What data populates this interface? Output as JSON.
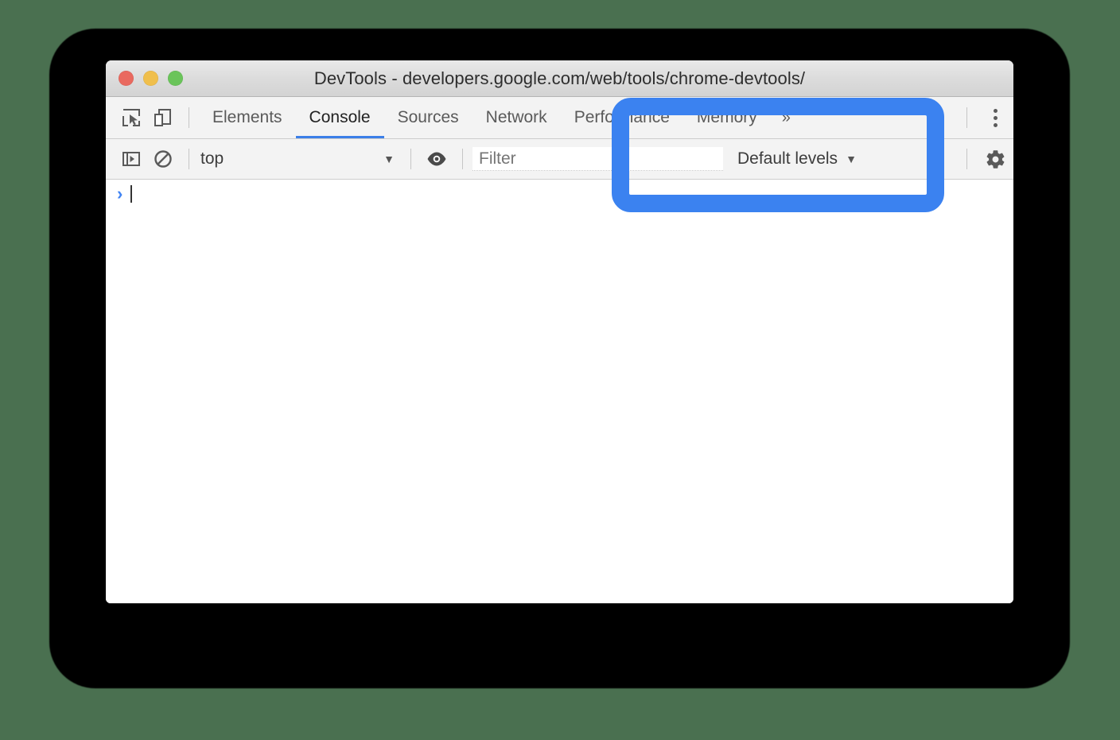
{
  "window": {
    "title": "DevTools - developers.google.com/web/tools/chrome-devtools/",
    "traffic_lights": [
      {
        "name": "close",
        "color": "#e9695f"
      },
      {
        "name": "minimize",
        "color": "#f0bf4c"
      },
      {
        "name": "maximize",
        "color": "#6ac45a"
      }
    ]
  },
  "colors": {
    "page_background": "#4a7050",
    "accent_blue": "#3b82f0",
    "tab_active_underline": "#3b7fe8",
    "prompt_blue": "#4184f3",
    "toolbar_background": "#f3f3f3",
    "titlebar_background": "#dcdcdc"
  },
  "tabbar": {
    "icons": [
      {
        "name": "inspect-element-icon",
        "label": "Inspect element"
      },
      {
        "name": "device-toolbar-icon",
        "label": "Toggle device toolbar"
      }
    ],
    "tabs": [
      {
        "label": "Elements",
        "active": false
      },
      {
        "label": "Console",
        "active": true
      },
      {
        "label": "Sources",
        "active": false
      },
      {
        "label": "Network",
        "active": false
      },
      {
        "label": "Performance",
        "active": false
      },
      {
        "label": "Memory",
        "active": false
      }
    ],
    "overflow_label": "»",
    "more_menu": {
      "name": "kebab-menu-icon",
      "label": "Customize and control DevTools"
    }
  },
  "filterbar": {
    "icons": [
      {
        "name": "console-sidebar-icon",
        "label": "Show console sidebar"
      },
      {
        "name": "clear-console-icon",
        "label": "Clear console"
      },
      {
        "name": "live-expression-icon",
        "label": "Create live expression"
      }
    ],
    "context": {
      "value": "top",
      "caret": "▼"
    },
    "filter": {
      "placeholder": "Filter",
      "value": ""
    },
    "levels": {
      "label": "Default levels",
      "caret": "▼"
    },
    "settings": {
      "name": "gear-icon",
      "label": "Settings"
    }
  },
  "console": {
    "prompt_chevron": "›",
    "input_value": ""
  },
  "annotation": {
    "name": "highlight-box",
    "color": "#3b82f0",
    "shape": "rounded-rectangle-outline",
    "targets": "Default levels dropdown"
  }
}
